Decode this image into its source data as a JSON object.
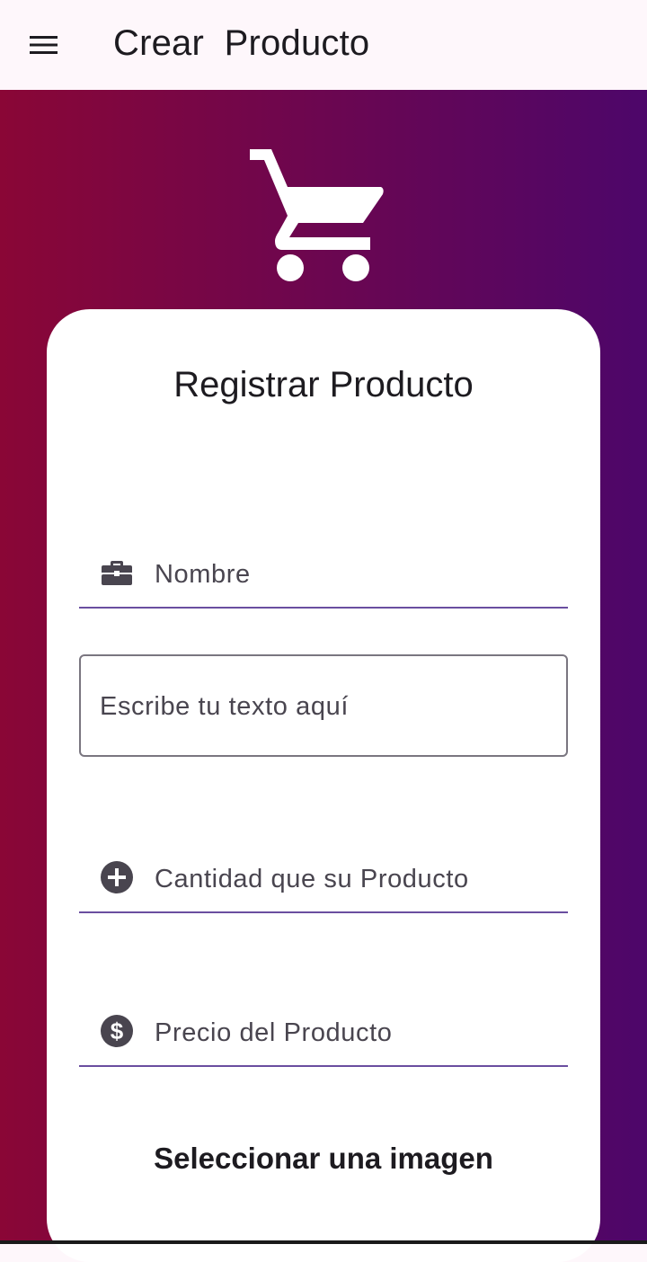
{
  "appbar": {
    "title": "Crear  Producto",
    "menu_icon": "menu-icon"
  },
  "background": {
    "gradient_start": "#8a0636",
    "gradient_end": "#4d066a"
  },
  "hero_icon": "shopping-cart-icon",
  "card": {
    "title": "Registrar Producto",
    "fields": {
      "nombre": {
        "label": "Nombre",
        "icon": "briefcase-icon"
      },
      "descripcion": {
        "placeholder": "Escribe tu texto aquí"
      },
      "cantidad": {
        "label": "Cantidad que su Producto",
        "icon": "add-circle-icon"
      },
      "precio": {
        "label": "Precio del Producto",
        "icon": "dollar-circle-icon"
      }
    },
    "select_image_label": "Seleccionar una imagen"
  },
  "colors": {
    "underline": "#6a4ea0",
    "icon": "#49454f"
  }
}
